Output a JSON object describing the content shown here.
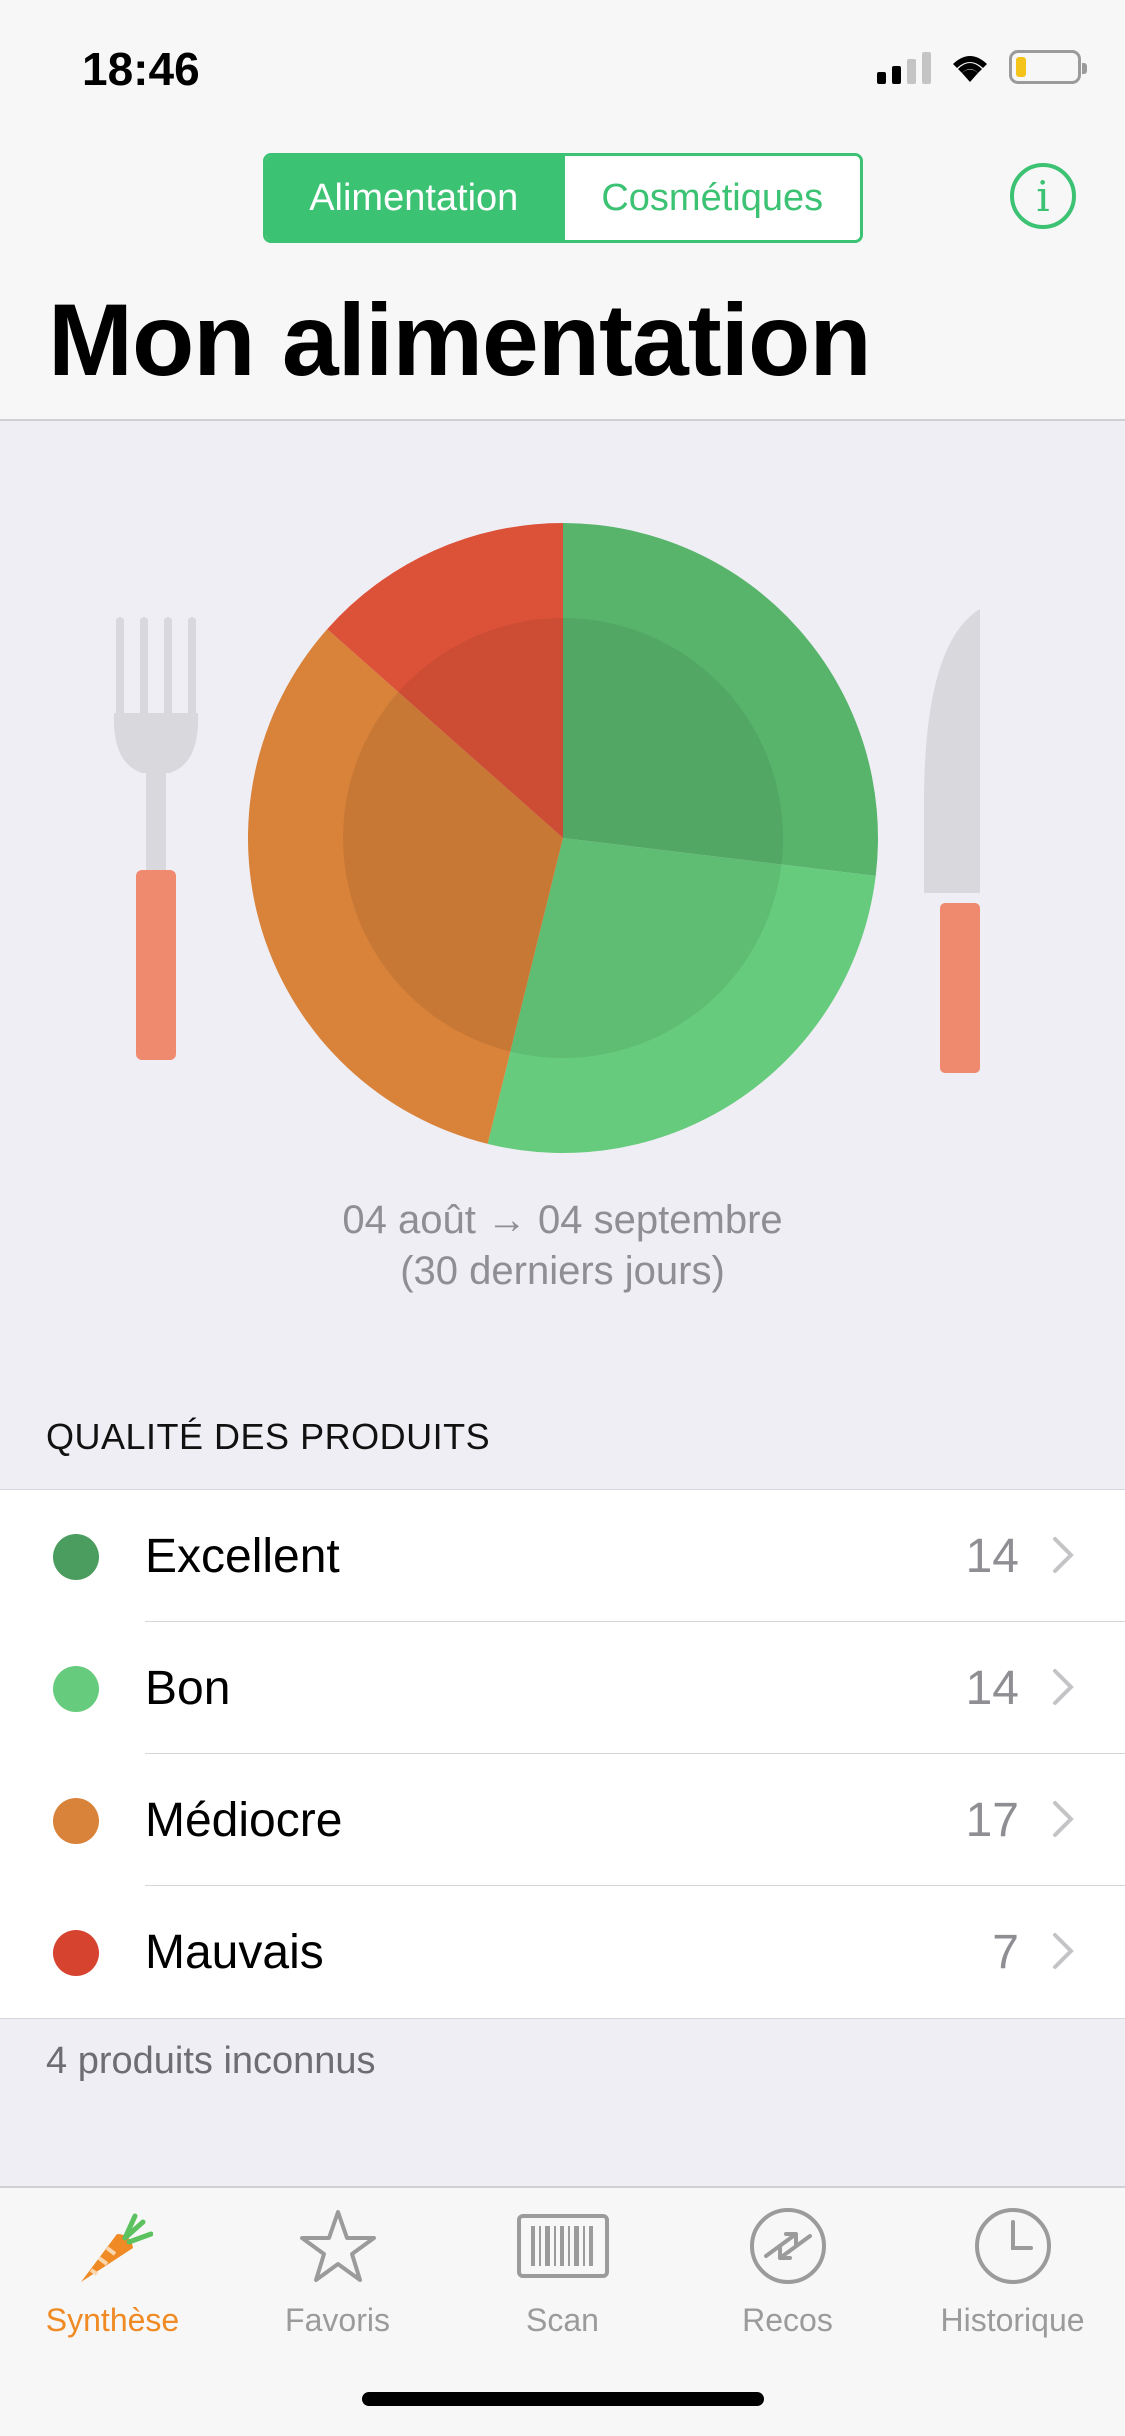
{
  "status_bar": {
    "time": "18:46"
  },
  "segment": {
    "active": "Alimentation",
    "inactive": "Cosmétiques"
  },
  "info_button": {
    "glyph": "i"
  },
  "title": "Mon alimentation",
  "period": {
    "range": "04 août → 04 septembre",
    "sub": "(30 derniers jours)"
  },
  "chart_data": {
    "type": "pie",
    "categories": [
      "Excellent",
      "Bon",
      "Médiocre",
      "Mauvais"
    ],
    "values": [
      14,
      14,
      17,
      7
    ],
    "colors": [
      "#58b46b",
      "#66cb7c",
      "#d8823a",
      "#dc5239"
    ]
  },
  "section_header": "QUALITÉ DES PRODUITS",
  "rows": [
    {
      "label": "Excellent",
      "count": "14",
      "color": "#4a9d5e"
    },
    {
      "label": "Bon",
      "count": "14",
      "color": "#66cb7c"
    },
    {
      "label": "Médiocre",
      "count": "17",
      "color": "#d8823a"
    },
    {
      "label": "Mauvais",
      "count": "7",
      "color": "#d64430"
    }
  ],
  "unknown_products": "4 produits inconnus",
  "tabs": [
    {
      "label": "Synthèse",
      "icon": "carrot-icon",
      "active": true
    },
    {
      "label": "Favoris",
      "icon": "star-icon",
      "active": false
    },
    {
      "label": "Scan",
      "icon": "barcode-icon",
      "active": false
    },
    {
      "label": "Recos",
      "icon": "swap-arrows-icon",
      "active": false
    },
    {
      "label": "Historique",
      "icon": "clock-icon",
      "active": false
    }
  ],
  "accent_color": "#3cc273",
  "tab_active_color": "#f08a24"
}
